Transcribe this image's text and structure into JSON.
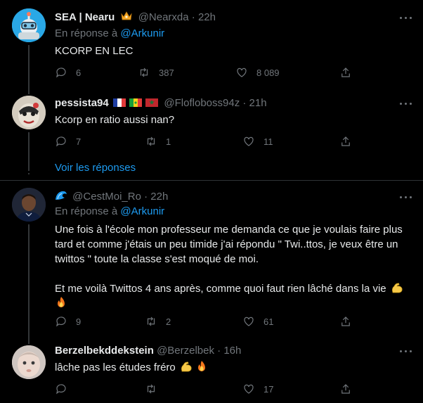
{
  "tweets": [
    {
      "name": "SEA | Nearu",
      "badge_icon": "crown-emoji-icon",
      "handle": "@Nearxda",
      "time": "· 22h",
      "reply_prefix": "En réponse à",
      "reply_mention": "@Arkunir",
      "text": "KCORP EN LEC",
      "replies": "6",
      "retweets": "387",
      "likes": "8 089"
    },
    {
      "name": "pessista94",
      "flags": [
        "france-flag-icon",
        "senegal-flag-icon",
        "morocco-flag-icon"
      ],
      "handle": "@Flofloboss94z",
      "time": "· 21h",
      "text": "Kcorp en ratio aussi nan?",
      "replies": "7",
      "retweets": "1",
      "likes": "11"
    },
    {
      "name": "",
      "name_icon": "wave-emoji-icon",
      "handle": "@CestMoi_Ro",
      "time": "· 22h",
      "reply_prefix": "En réponse à",
      "reply_mention": "@Arkunir",
      "text_lines": [
        "Une fois à l'école mon professeur me demanda ce que je voulais faire plus",
        "tard et comme j'étais un peu timide j'ai répondu \" Twi..ttos, je veux être un",
        "twittos \" toute la classe s'est moqué de moi.",
        "",
        "Et me voilà Twittos 4 ans après, comme quoi faut rien lâché dans la vie"
      ],
      "replies": "9",
      "retweets": "2",
      "likes": "61"
    },
    {
      "name": "Berzelbekddekstein",
      "handle": "@Berzelbek",
      "time": "· 16h",
      "text": "lâche pas les études fréro",
      "replies": "",
      "retweets": "",
      "likes": "17"
    }
  ],
  "show_replies": "Voir les réponses",
  "colors": {
    "background": "#000000",
    "text": "#e7e9ea",
    "secondary": "#71767b",
    "accent": "#1d9bf0",
    "divider": "#2f3336"
  }
}
